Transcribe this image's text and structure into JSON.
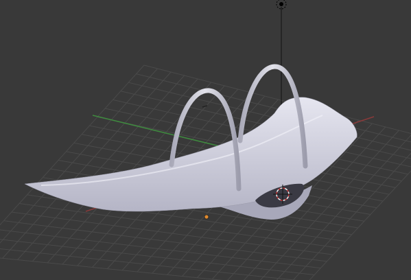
{
  "viewport": {
    "background": "#393939",
    "grid_color": "#4a4a4a",
    "x_axis_color": "#8a3a3a",
    "y_axis_color": "#3f8a3f",
    "mesh_color": "#d9d9e6",
    "mesh_shadow_color": "#9c9cae",
    "cursor_colors": [
      "#c83232",
      "#f0f0f0"
    ],
    "origin_color": "#e08a2e",
    "lamp_icon": "light-lamp-icon",
    "camera_icon": "camera-icon"
  }
}
